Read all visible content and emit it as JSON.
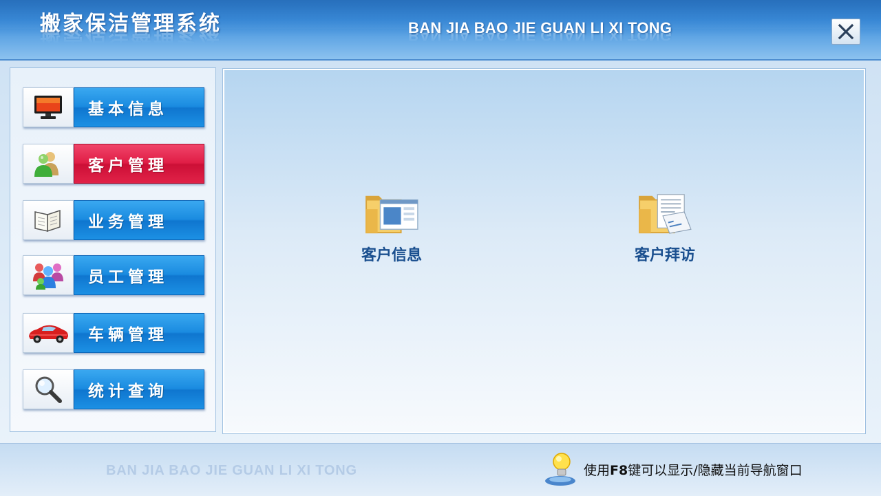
{
  "header": {
    "title_cn": "搬家保洁管理系统",
    "title_en": "BAN JIA BAO JIE GUAN LI XI TONG",
    "close_icon": "close-icon"
  },
  "nav": {
    "items": [
      {
        "label": "基本信息",
        "icon": "monitor-icon",
        "active": false
      },
      {
        "label": "客户管理",
        "icon": "users-icon",
        "active": true
      },
      {
        "label": "业务管理",
        "icon": "book-icon",
        "active": false
      },
      {
        "label": "员工管理",
        "icon": "group-icon",
        "active": false
      },
      {
        "label": "车辆管理",
        "icon": "car-icon",
        "active": false
      },
      {
        "label": "统计查询",
        "icon": "magnifier-icon",
        "active": false
      }
    ]
  },
  "content": {
    "tiles": [
      {
        "label": "客户信息",
        "icon": "folder-window-icon"
      },
      {
        "label": "客户拜访",
        "icon": "folder-document-icon"
      }
    ]
  },
  "footer": {
    "watermark": "BAN JIA BAO JIE GUAN LI XI TONG",
    "hint_prefix": "使用",
    "hint_key": "F8",
    "hint_suffix": "键可以显示/隐藏当前导航窗口",
    "hint_icon": "lightbulb-icon"
  },
  "colors": {
    "header_blue": "#2f82d3",
    "nav_blue": "#1a8be0",
    "nav_active_red": "#e01d45",
    "tile_text": "#1a4f8f"
  }
}
